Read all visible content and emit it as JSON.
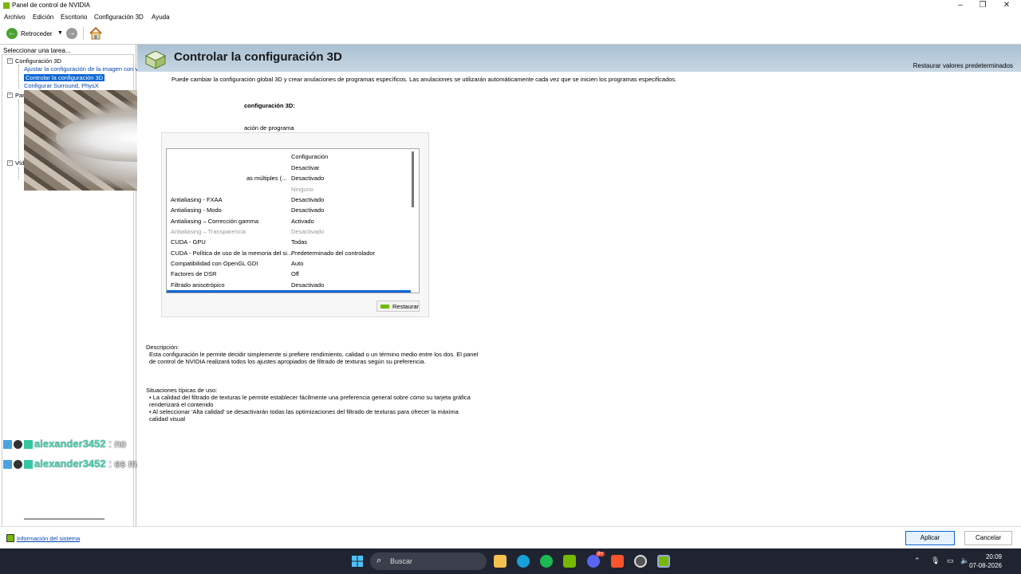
{
  "window": {
    "title": "Panel de control de NVIDIA"
  },
  "menu": [
    "Archivo",
    "Edición",
    "Escritorio",
    "Configuración 3D",
    "Ayuda"
  ],
  "toolbar": {
    "back_label": "Retroceder"
  },
  "left_panel": {
    "heading": "Seleccionar una tarea...",
    "items": [
      {
        "label": "Configuración 3D"
      },
      {
        "label": "Ajustar la configuración de la imagen con v"
      },
      {
        "label": "Controlar la configuración 3D"
      },
      {
        "label": "Configurar Surround, PhysX"
      },
      {
        "label": "Par"
      },
      {
        "label": "Víd"
      }
    ]
  },
  "chat": [
    {
      "name": "alexander3452",
      "msg": " : no"
    },
    {
      "name": "alexander3452",
      "msg": " : es malo"
    }
  ],
  "page": {
    "title": "Controlar la configuración 3D",
    "restore_defaults": "Restaurar valores predeterminados",
    "intro": "Puede cambiar la configuración global 3D y crear anulaciones de programas específicos. Las anulaciones se utilizarán automáticamente cada vez que se inicien los programas especificados.",
    "section_label": "configuración 3D:",
    "tab_program": "ación de programa",
    "column_setting": "Configuración",
    "settings": [
      {
        "feature": "",
        "value": "Desactivar",
        "dim": false
      },
      {
        "feature": "as múltiples (...",
        "value": "Desactivado",
        "dim": false
      },
      {
        "feature": "",
        "value": "Ninguno",
        "dim": true
      },
      {
        "feature": "Antialiasing - FXAA",
        "value": "Desactivado",
        "dim": false
      },
      {
        "feature": "Antialiasing - Modo",
        "value": "Desactivado",
        "dim": false
      },
      {
        "feature": "Antialiasing – Corrección gamma",
        "value": "Activado",
        "dim": false
      },
      {
        "feature": "Antialiasing – Transparencia",
        "value": "Desactivado",
        "dim": true
      },
      {
        "feature": "CUDA - GPU",
        "value": "Todas",
        "dim": false
      },
      {
        "feature": "CUDA - Política de uso de la memoria del si...",
        "value": "Predeterminado del controlador",
        "dim": false
      },
      {
        "feature": "Compatibilidad con OpenGL GDI",
        "value": "Auto",
        "dim": false
      },
      {
        "feature": "Factores de DSR",
        "value": "Off",
        "dim": false
      },
      {
        "feature": "Filtrado anisotrópico",
        "value": "Desactivado",
        "dim": false
      }
    ],
    "restore_button": "Restaurar",
    "description_label": "Descripción:",
    "description_text_1": "Esta configuración le permite decidir simplemente si prefiere rendimiento, calidad o un término medio entre los dos. El panel",
    "description_text_2": "de control de NVIDIA realizará todos los ajustes apropiados de filtrado de texturas según su preferencia.",
    "usage_label": "Situaciones típicas de uso:",
    "usage_1a": "• La calidad del filtrado de texturas le permite establecer fácilmente una preferencia general sobre cómo su tarjeta gráfica",
    "usage_1b": "renderizará el contenido",
    "usage_2a": "• Al seleccionar 'Alta calidad' se desactivarán todas las optimizaciones del filtrado de texturas para ofrecer la máxima",
    "usage_2b": "calidad visual"
  },
  "footer": {
    "system_info": "Información del sistema",
    "apply": "Aplicar",
    "cancel": "Cancelar"
  },
  "taskbar": {
    "search_placeholder": "Buscar",
    "time": "20:09",
    "date": "07-08-2026",
    "discord_badge": "9+"
  },
  "colors": {
    "nvidia_green": "#76b900",
    "selection": "#0a66d4",
    "banner": "#b6cad9",
    "taskbar": "#1f2430"
  }
}
